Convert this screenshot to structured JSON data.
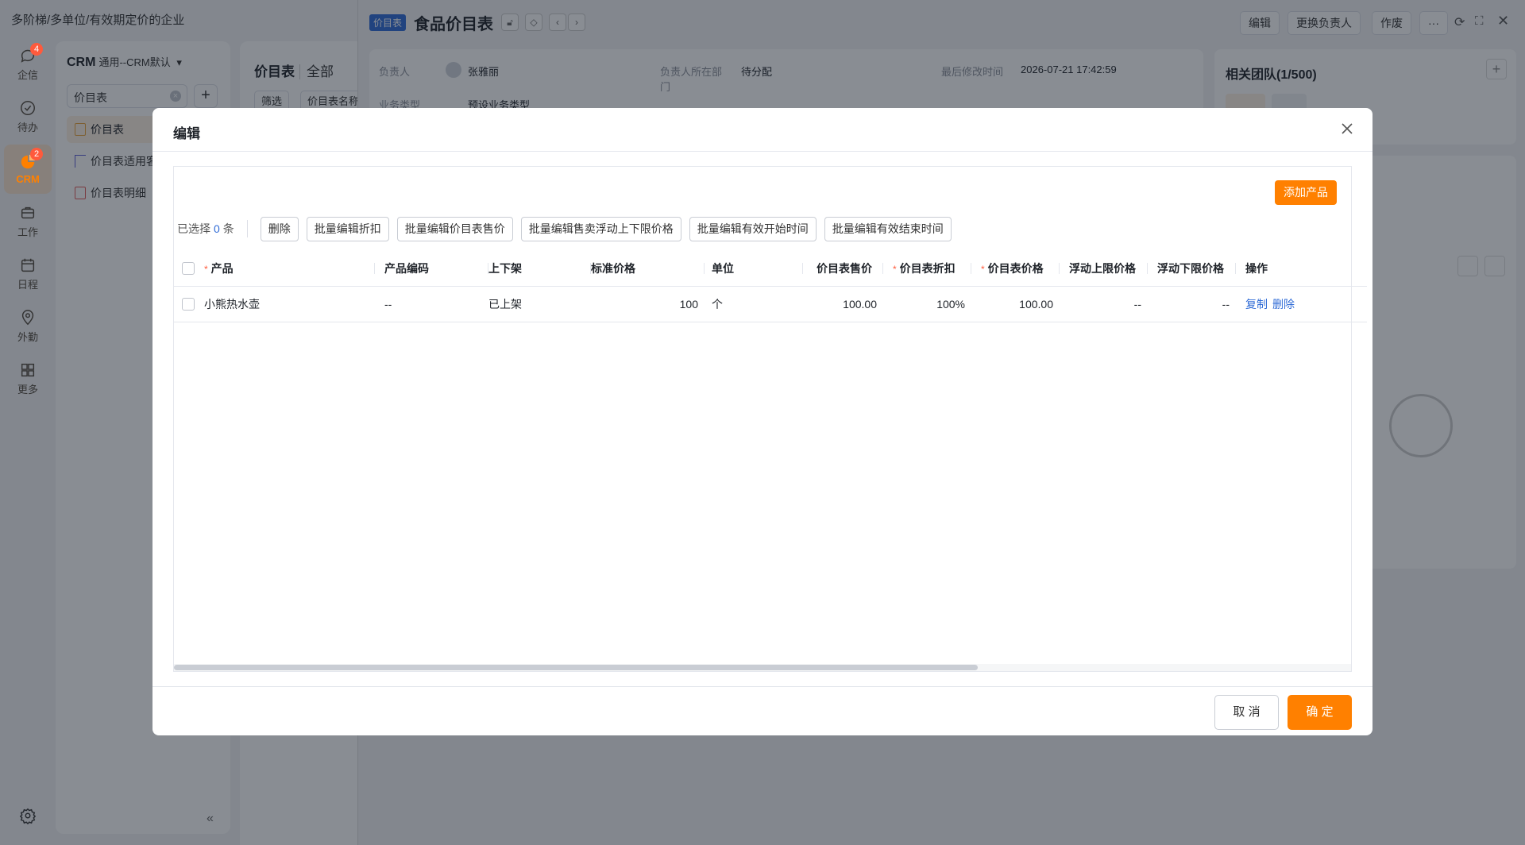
{
  "app": {
    "title": "多阶梯/多单位/有效期定价的企业"
  },
  "rail": {
    "items": [
      {
        "label": "企信",
        "badge": "4"
      },
      {
        "label": "待办",
        "badge": ""
      },
      {
        "label": "CRM",
        "badge": "2"
      },
      {
        "label": "工作",
        "badge": ""
      },
      {
        "label": "日程",
        "badge": ""
      },
      {
        "label": "外勤",
        "badge": ""
      },
      {
        "label": "更多",
        "badge": ""
      }
    ]
  },
  "subnav": {
    "title": "CRM",
    "subtitle": "通用--CRM默认",
    "search_value": "价目表",
    "items": [
      {
        "label": "价目表"
      },
      {
        "label": "价目表适用客"
      },
      {
        "label": "价目表明细"
      }
    ],
    "collapse": "«"
  },
  "listcol": {
    "title": "价目表",
    "scope": "全部",
    "filter_label": "筛选",
    "name_label": "价目表名称"
  },
  "detail": {
    "tag": "价目表",
    "title": "食品价目表",
    "buttons": {
      "edit": "编辑",
      "change_owner": "更换负责人",
      "void": "作废",
      "more": "···"
    },
    "owner_label": "负责人",
    "owner_value": "张雅丽",
    "dept_label": "负责人所在部门",
    "dept_value": "待分配",
    "modified_label": "最后修改时间",
    "modified_value": "2026-07-21 17:42:59",
    "biz_label": "业务类型",
    "biz_value": "预设业务类型",
    "team_title": "相关团队(1/500)"
  },
  "modal": {
    "title": "编辑",
    "add_product": "添加产品",
    "selected_prefix": "已选择",
    "selected_count": "0",
    "selected_suffix": "条",
    "toolbar": [
      "删除",
      "批量编辑折扣",
      "批量编辑价目表售价",
      "批量编辑售卖浮动上下限价格",
      "批量编辑有效开始时间",
      "批量编辑有效结束时间"
    ],
    "columns": [
      {
        "label": "产品",
        "required": true
      },
      {
        "label": "产品编码",
        "required": false
      },
      {
        "label": "上下架",
        "required": false
      },
      {
        "label": "标准价格",
        "required": false
      },
      {
        "label": "单位",
        "required": false
      },
      {
        "label": "价目表售价",
        "required": false
      },
      {
        "label": "价目表折扣",
        "required": true
      },
      {
        "label": "价目表价格",
        "required": true
      },
      {
        "label": "浮动上限价格",
        "required": false
      },
      {
        "label": "浮动下限价格",
        "required": false
      },
      {
        "label": "操作",
        "required": false
      }
    ],
    "rows": [
      {
        "product": "小熊热水壶",
        "code": "--",
        "status": "已上架",
        "std_price": "100",
        "unit": "个",
        "sale_price": "100.00",
        "discount": "100%",
        "list_price": "100.00",
        "upper": "--",
        "lower": "--",
        "action_copy": "复制",
        "action_delete": "删除"
      }
    ],
    "cancel": "取 消",
    "confirm": "确 定"
  }
}
